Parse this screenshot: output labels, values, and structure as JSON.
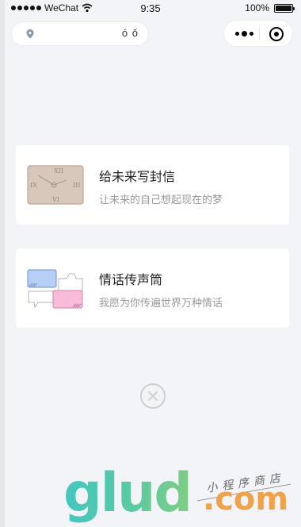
{
  "status_bar": {
    "carrier": "WeChat",
    "time": "9:35",
    "battery_percent": "100%",
    "battery_level": 1.0
  },
  "top_bar": {
    "pill_glyph": "ó ǒ"
  },
  "cards": [
    {
      "title": "给未来写封信",
      "subtitle": "让未来的自己想起现在的梦",
      "icon": "clock-icon"
    },
    {
      "title": "情话传声筒",
      "subtitle": "我愿为你传遍世界万种情话",
      "icon": "chat-bubbles-icon"
    }
  ],
  "close_button": {
    "icon": "close-circle-icon"
  },
  "watermark": {
    "brand": "glud",
    "domain": ".com",
    "slogan": "小程序商店"
  },
  "colors": {
    "background": "#f3f4f7",
    "card": "#ffffff",
    "title": "#1e1e1e",
    "subtitle": "#9a9a9a",
    "watermark_teal": "#44c6c0",
    "watermark_orange": "#f0a24a"
  }
}
